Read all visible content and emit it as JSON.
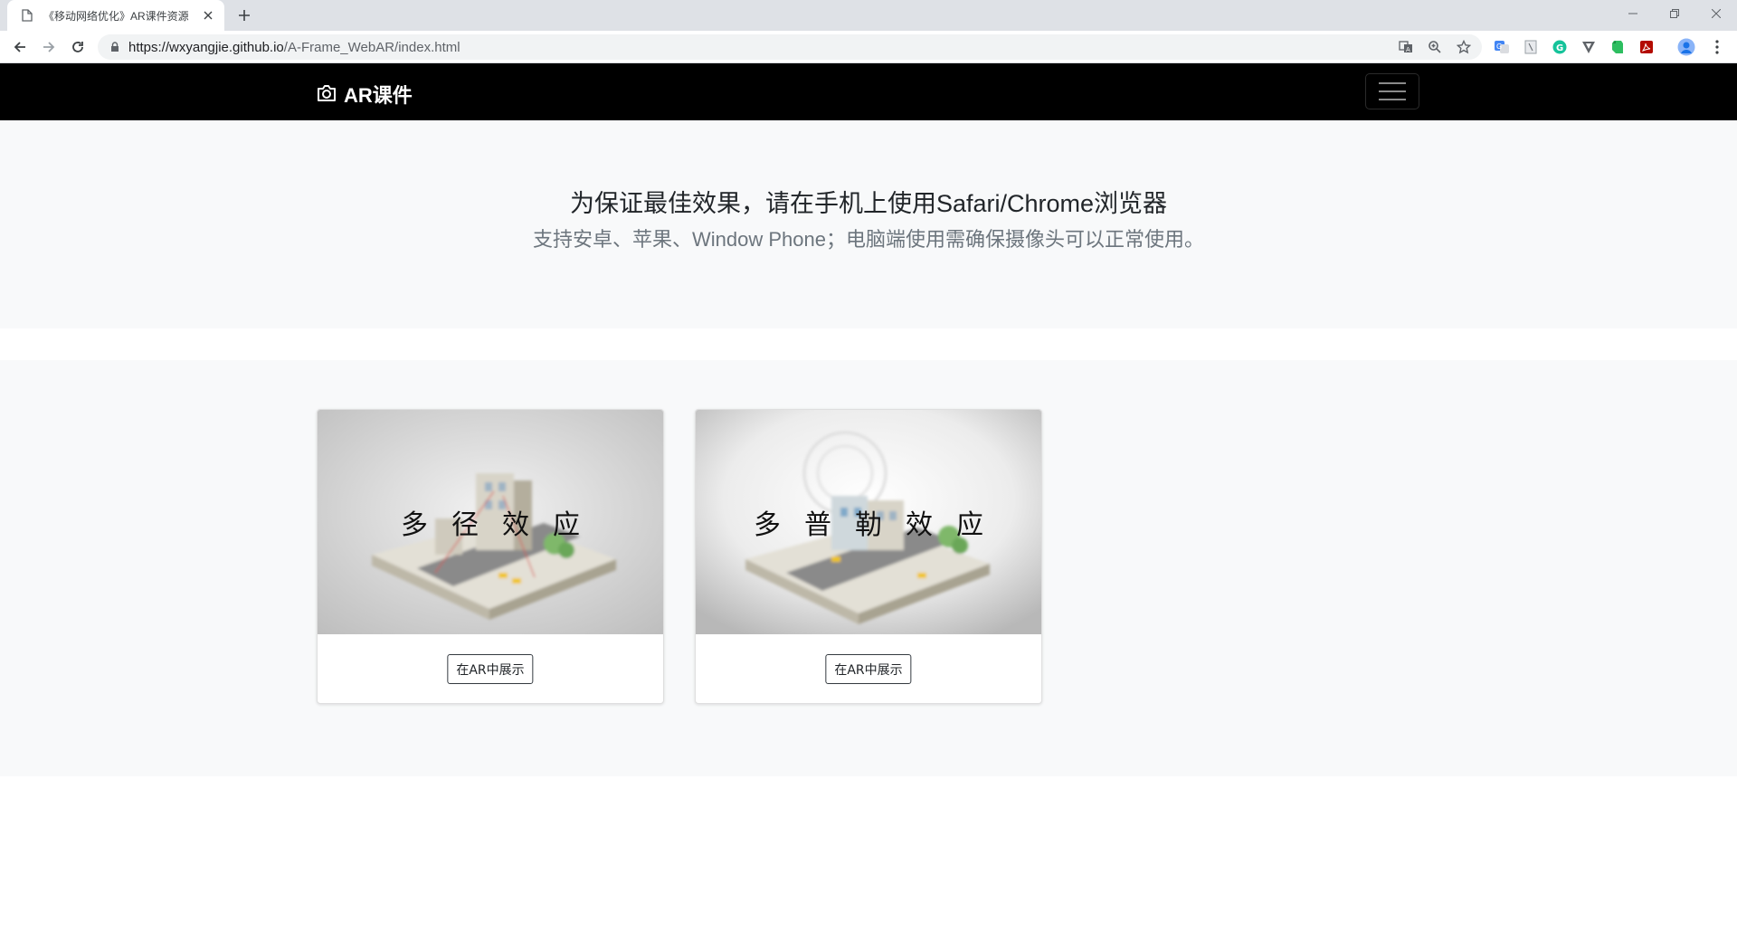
{
  "browser": {
    "tab_title": "《移动网络优化》AR课件资源",
    "url_host": "https://wxyangjie.github.io",
    "url_path": "/A-Frame_WebAR/index.html",
    "icons": {
      "tab": "page-icon",
      "close": "close-icon",
      "new_tab": "plus-icon",
      "back": "back-arrow-icon",
      "forward": "forward-arrow-icon",
      "reload": "reload-icon",
      "lock": "lock-icon",
      "translate": "translate-icon",
      "zoom": "zoom-icon",
      "bookmark": "star-icon",
      "menu": "kebab-menu-icon"
    },
    "extensions": [
      "translate-extension-icon",
      "reader-extension-icon",
      "grammarly-icon",
      "vpn-extension-icon",
      "evernote-icon",
      "pdf-extension-icon",
      "profile-avatar-icon"
    ]
  },
  "navbar": {
    "brand": "AR课件",
    "brand_icon": "camera-icon",
    "toggler_icon": "hamburger-icon",
    "background": "#000000"
  },
  "jumbotron": {
    "title": "为保证最佳效果，请在手机上使用Safari/Chrome浏览器",
    "subtitle": "支持安卓、苹果、Window Phone；电脑端使用需确保摄像头可以正常使用。"
  },
  "cards": [
    {
      "label": "多径效应",
      "button": "在AR中展示"
    },
    {
      "label": "多普勒效应",
      "button": "在AR中展示"
    }
  ]
}
